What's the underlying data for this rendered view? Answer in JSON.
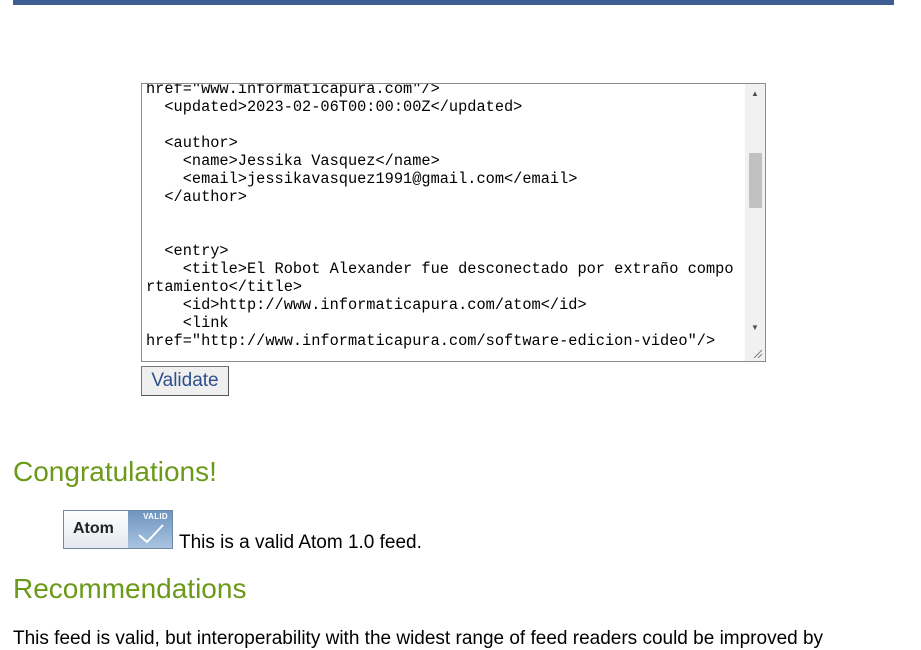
{
  "feed_source": "href=\"www.informaticapura.com\"/>\n  <updated>2023-02-06T00:00:00Z</updated>\n\n  <author>\n    <name>Jessika Vasquez</name>\n    <email>jessikavasquez1991@gmail.com</email>\n  </author>\n\n\n  <entry>\n    <title>El Robot Alexander fue desconectado por extraño comportamiento</title>\n    <id>http://www.informaticapura.com/atom</id>\n    <link\nhref=\"http://www.informaticapura.com/software-edicion-video\"/>",
  "validate_label": "Validate",
  "congrats_heading": "Congratulations!",
  "badge": {
    "label": "Atom",
    "tag": "VALID"
  },
  "valid_message": "This is a valid Atom 1.0 feed.",
  "recommendations_heading": "Recommendations",
  "recommendations_text": "This feed is valid, but interoperability with the widest range of feed readers could be improved by",
  "colors": {
    "accent_bar": "#3f5f94",
    "heading_green": "#6b9a1a",
    "button_text": "#2f4f8a"
  }
}
